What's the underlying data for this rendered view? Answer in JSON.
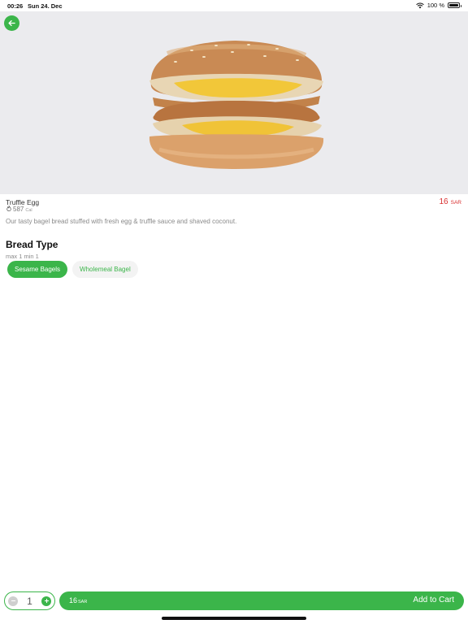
{
  "status_bar": {
    "time": "00:26",
    "date": "Sun 24. Dec",
    "battery": "100 %",
    "icons": [
      "wifi-icon",
      "battery-icon"
    ]
  },
  "product": {
    "name": "Truffle Egg",
    "calories": "587",
    "calories_unit": "Cal",
    "price": "16",
    "currency": "SAR",
    "description": "Our tasty bagel bread stuffed with fresh egg & truffle sauce and shaved coconut."
  },
  "options_section": {
    "title": "Bread Type",
    "rule": "max 1 min 1",
    "options": [
      {
        "label": "Sesame Bagels",
        "selected": true
      },
      {
        "label": "Wholemeal Bagel",
        "selected": false
      }
    ]
  },
  "cart": {
    "quantity": "1",
    "price": "16",
    "currency": "SAR",
    "button_label": "Add to Cart"
  },
  "colors": {
    "accent": "#3bb54a",
    "price": "#d92f2f",
    "hero_bg": "#ebebee"
  },
  "icons": {
    "back": "arrow-left-icon",
    "calories": "flame-icon",
    "minus": "minus-icon",
    "plus": "plus-icon"
  }
}
